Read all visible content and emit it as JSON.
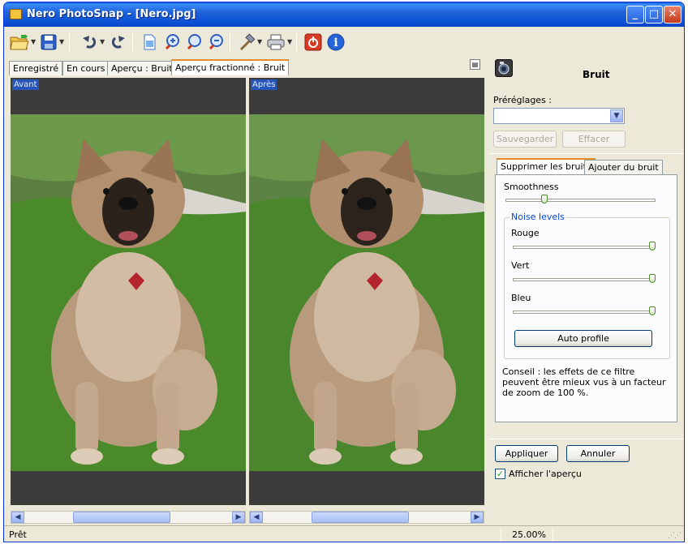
{
  "window": {
    "title": "Nero PhotoSnap - [Nero.jpg]",
    "controls": {
      "minimize": "_",
      "maximize": "□",
      "close": "✕"
    }
  },
  "toolbar": {
    "items": [
      "open-folder",
      "save",
      "undo",
      "redo",
      "new-page",
      "zoom-in",
      "zoom-actual",
      "zoom-out",
      "tools",
      "print",
      "exit",
      "info"
    ]
  },
  "tabs": [
    {
      "label": "Enregistré"
    },
    {
      "label": "En cours"
    },
    {
      "label": "Aperçu : Bruit"
    },
    {
      "label": "Aperçu fractionné : Bruit",
      "active": true
    }
  ],
  "preview": {
    "left_label": "Avant",
    "right_label": "Après"
  },
  "panel": {
    "title": "Bruit",
    "presets_label": "Préréglages :",
    "preset_value": "",
    "save_button": "Sauvegarder",
    "delete_button": "Effacer",
    "tabs": [
      {
        "label": "Supprimer les bruits",
        "active": true
      },
      {
        "label": "Ajouter du bruit"
      }
    ],
    "smoothness_label": "Smoothness",
    "smoothness_value": 0.24,
    "noise_levels_label": "Noise levels",
    "channels": [
      {
        "label": "Rouge",
        "value": 1.0
      },
      {
        "label": "Vert",
        "value": 1.0
      },
      {
        "label": "Bleu",
        "value": 1.0
      }
    ],
    "auto_profile_button": "Auto profile",
    "tip": "Conseil : les effets de ce filtre peuvent être mieux vus à un facteur de zoom de 100 %.",
    "apply_button": "Appliquer",
    "cancel_button": "Annuler",
    "show_preview_label": "Afficher l'aperçu",
    "show_preview_checked": true
  },
  "statusbar": {
    "status": "Prêt",
    "zoom": "25.00%"
  },
  "colors": {
    "titlebar": "#0b4fd4",
    "panel_bg": "#ece9d8",
    "accent_tab": "#e68b2c",
    "grass": "#4f8a2f",
    "dog_fur": "#b89b7d"
  }
}
